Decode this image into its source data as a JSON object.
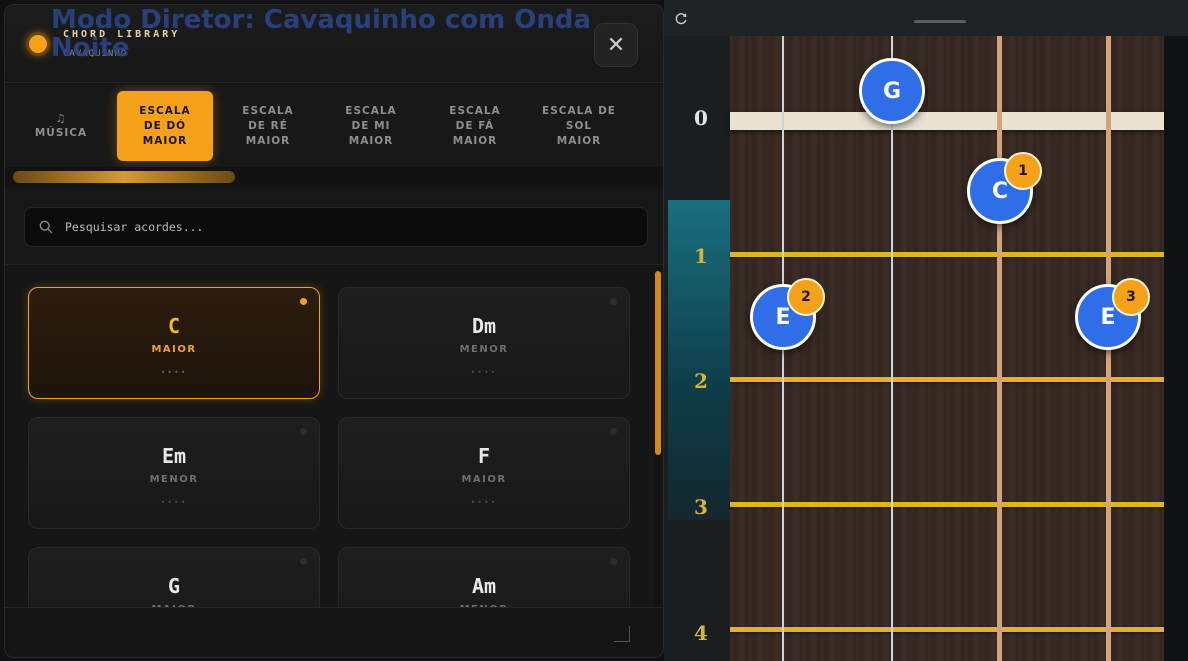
{
  "overlay": {
    "title": "Modo Diretor: Cavaquinho com Onda Noite"
  },
  "header": {
    "brand": "CHORD LIBRARY",
    "subtitle": "CAVAQUINHO",
    "close_label": "✕"
  },
  "tabs": [
    {
      "note": "♫",
      "label": "MÚSICA",
      "active": false
    },
    {
      "label": "ESCALA DE DÓ MAIOR",
      "active": true
    },
    {
      "label": "ESCALA DE RÉ MAIOR",
      "active": false
    },
    {
      "label": "ESCALA DE MI MAIOR",
      "active": false
    },
    {
      "label": "ESCALA DE FÁ MAIOR",
      "active": false
    },
    {
      "label": "ESCALA DE SOL MAIOR",
      "active": false
    }
  ],
  "search": {
    "placeholder": "Pesquisar acordes..."
  },
  "chords": [
    {
      "name": "C",
      "type": "MAIOR",
      "dots": "••••",
      "selected": true
    },
    {
      "name": "Dm",
      "type": "MENOR",
      "dots": "••••",
      "selected": false
    },
    {
      "name": "Em",
      "type": "MENOR",
      "dots": "••••",
      "selected": false
    },
    {
      "name": "F",
      "type": "MAIOR",
      "dots": "••••",
      "selected": false
    },
    {
      "name": "G",
      "type": "MAIOR",
      "dots": "••••",
      "selected": false
    },
    {
      "name": "Am",
      "type": "MENOR",
      "dots": "••••",
      "selected": false
    }
  ],
  "fretboard": {
    "fret_labels": [
      "0",
      "1",
      "2",
      "3",
      "4"
    ],
    "notes": [
      {
        "note": "G",
        "string": 2,
        "fret": 0,
        "finger": ""
      },
      {
        "note": "C",
        "string": 3,
        "fret": 1,
        "finger": "1"
      },
      {
        "note": "E",
        "string": 1,
        "fret": 2,
        "finger": "2"
      },
      {
        "note": "E",
        "string": 4,
        "fret": 2,
        "finger": "3"
      }
    ]
  },
  "colors": {
    "accent": "#f5a21a",
    "note_blue": "#2f6ee6",
    "fret_gold": "#e2b326"
  }
}
